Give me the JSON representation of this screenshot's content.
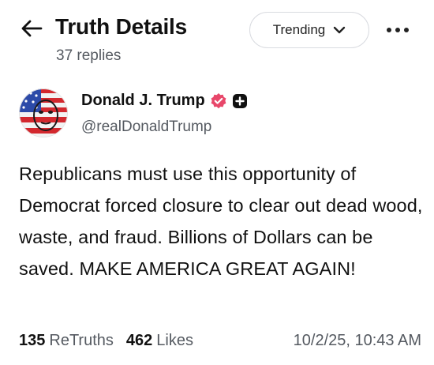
{
  "header": {
    "title": "Truth Details",
    "reply_count": "37 replies",
    "sort_label": "Trending"
  },
  "author": {
    "name": "Donald J. Trump",
    "handle": "@realDonaldTrump"
  },
  "post": {
    "text": "Republicans must use this opportunity of Democrat forced closure to clear out dead wood, waste, and fraud. Billions of Dollars can be saved. MAKE AMERICA GREAT AGAIN!"
  },
  "stats": {
    "retruths_count": "135",
    "retruths_label": "ReTruths",
    "likes_count": "462",
    "likes_label": "Likes",
    "timestamp": "10/2/25, 10:43 AM"
  },
  "colors": {
    "verified_badge": "#e8476a",
    "text_primary": "#111111",
    "text_secondary": "#555a61",
    "border": "#d9dbe0"
  },
  "icons": {
    "back": "arrow-left-icon",
    "dropdown": "chevron-down-icon",
    "more": "more-horizontal-icon",
    "verified": "verified-badge-icon",
    "plus": "plus-badge-icon"
  }
}
